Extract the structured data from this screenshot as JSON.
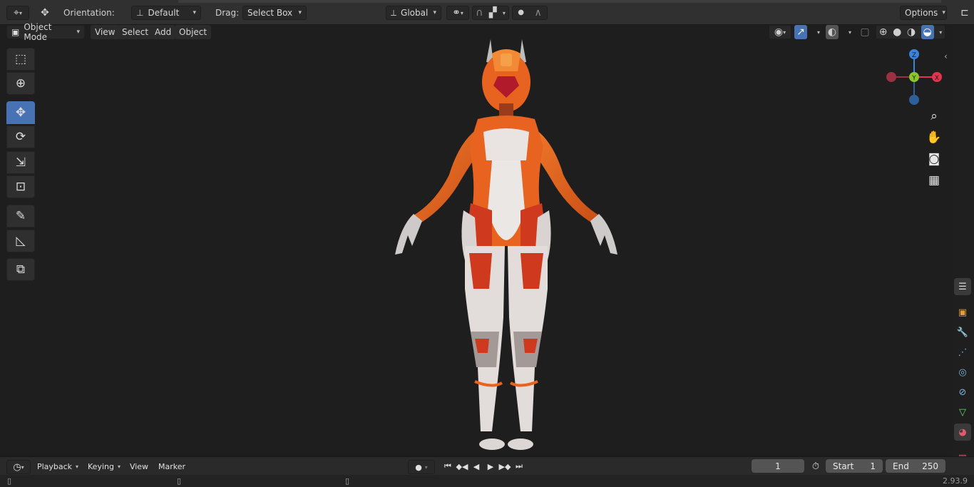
{
  "header": {
    "orientation_label": "Orientation:",
    "orientation_value": "Default",
    "drag_label": "Drag:",
    "drag_value": "Select Box",
    "transform_orientation": "Global",
    "options_label": "Options"
  },
  "viewport_header": {
    "mode": "Object Mode",
    "menus": [
      "View",
      "Select",
      "Add",
      "Object"
    ]
  },
  "gizmo": {
    "z": "Z",
    "y": "Y",
    "x": "X"
  },
  "timeline": {
    "editor_menus": [
      "Playback",
      "Keying",
      "View",
      "Marker"
    ],
    "current_frame": "1",
    "start_label": "Start",
    "start_value": "1",
    "end_label": "End",
    "end_value": "250"
  },
  "status": {
    "version": "2.93.9"
  },
  "colors": {
    "accent": "#4772b3",
    "x_axis": "#e2344f",
    "y_axis": "#8bc72a",
    "z_axis": "#3c84d9",
    "character_orange": "#e8631f"
  }
}
